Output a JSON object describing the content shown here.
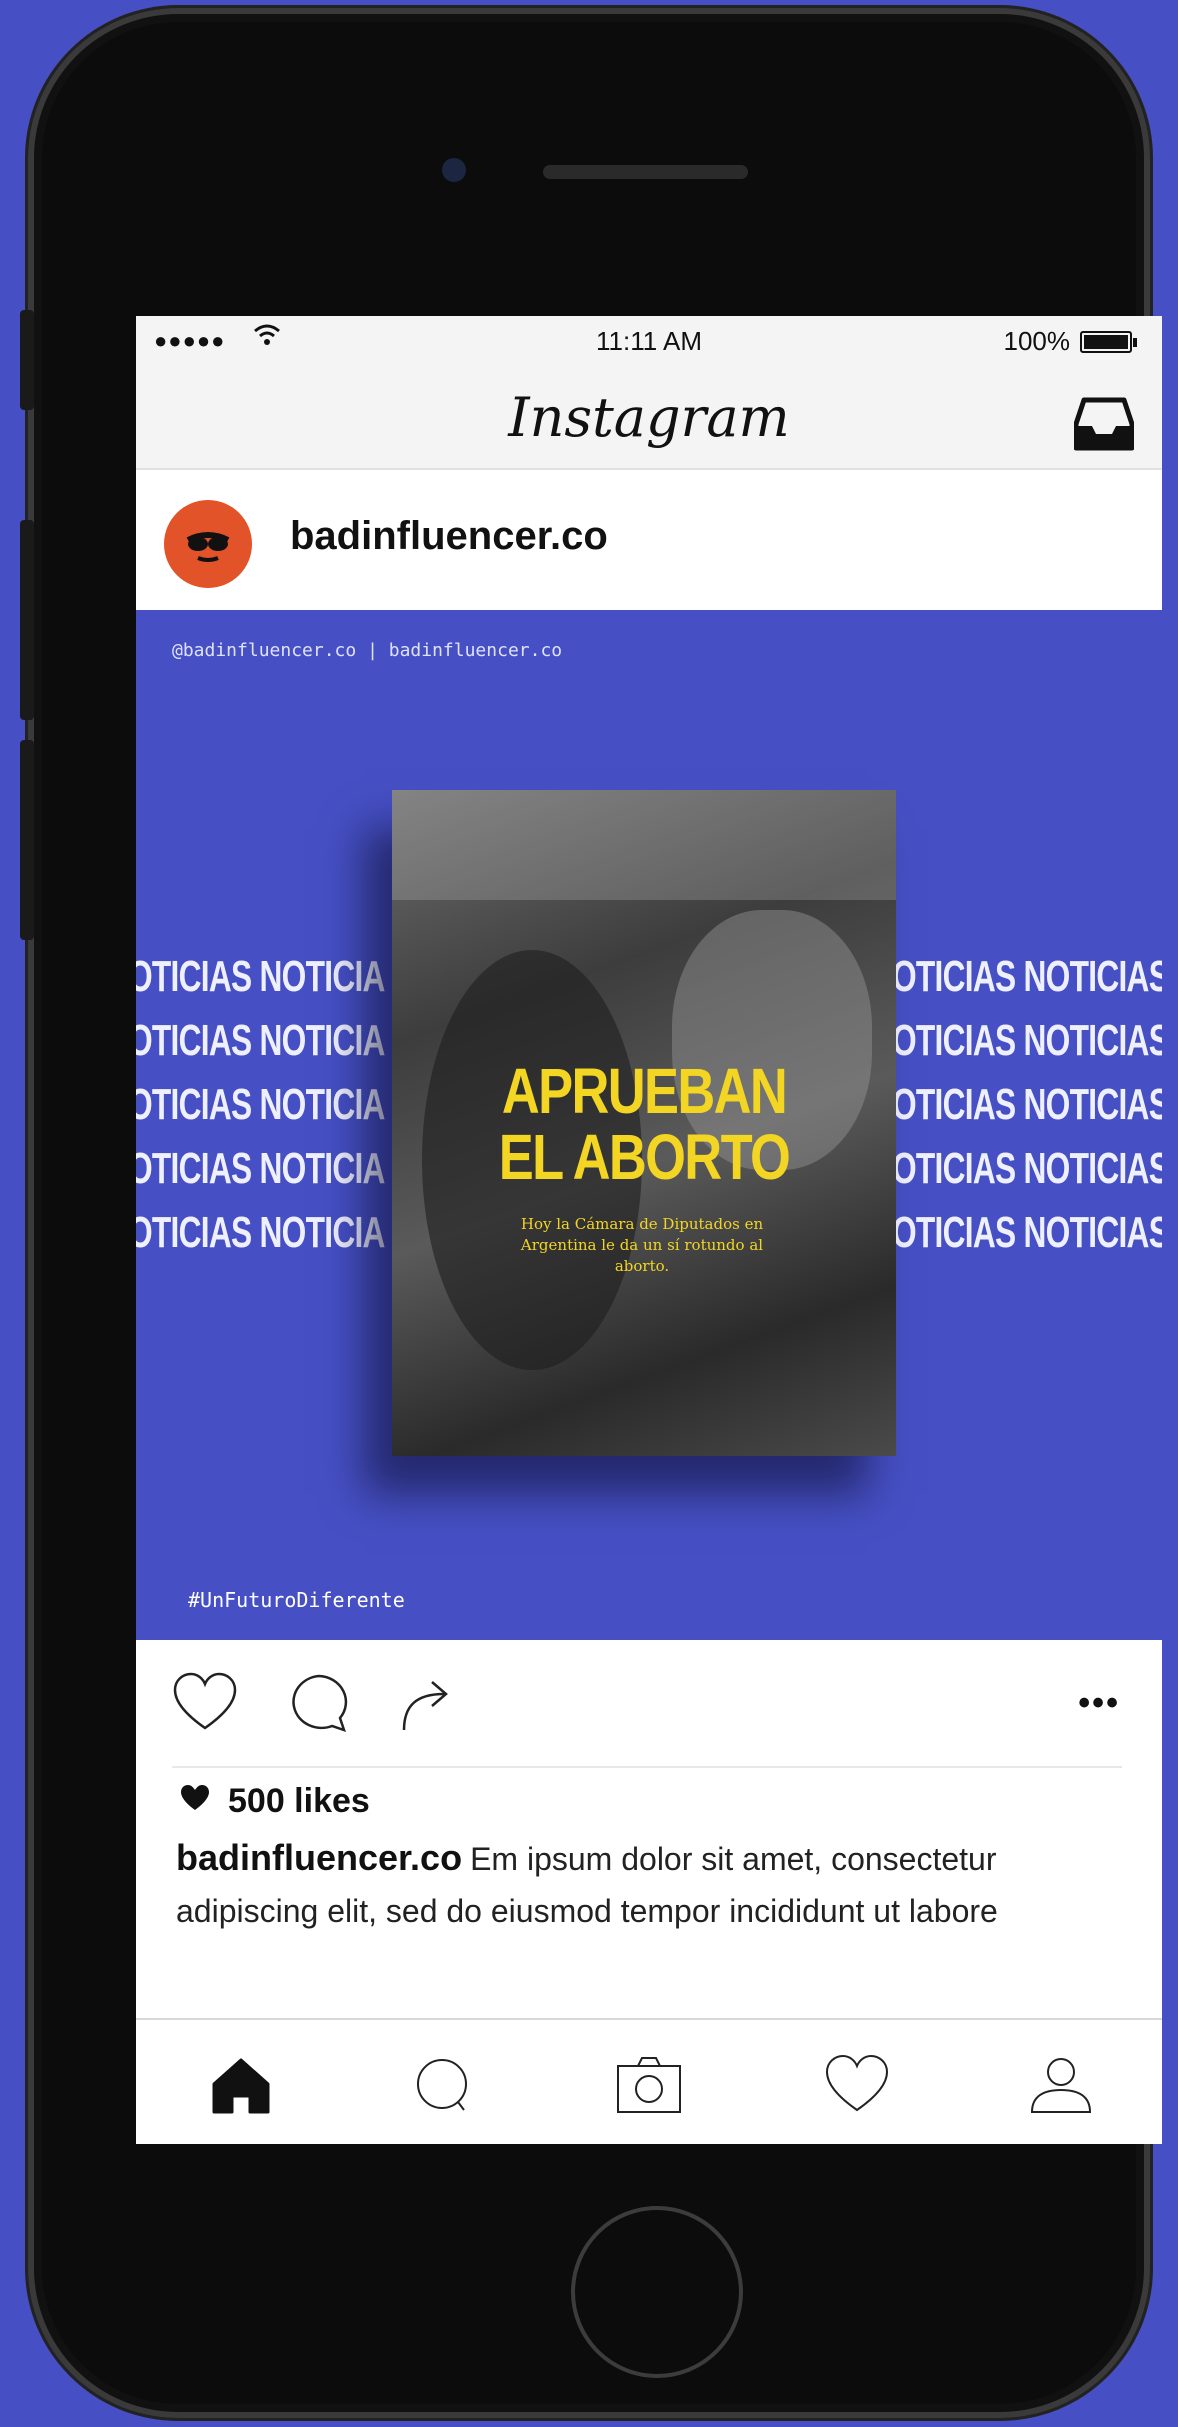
{
  "status_bar": {
    "signal": "●●●●●",
    "time": "11:11 AM",
    "battery": "100%"
  },
  "app": {
    "logo": "Instagram"
  },
  "post": {
    "username": "badinfluencer.co",
    "credits": "@badinfluencer.co | badinfluencer.co",
    "hashtag": "#UnFuturoDiferente",
    "news_word_left": "OTICIAS NOTICIA",
    "news_word_right": "OTICIAS NOTICIAS",
    "headline_line1": "APRUEBAN",
    "headline_line2": "EL ABORTO",
    "subtitle": "Hoy la Cámara de Diputados en Argentina le da un sí rotundo al aborto.",
    "likes": "500 likes",
    "caption_user": "badinfluencer.co",
    "caption_text": "Em ipsum dolor sit amet, consectetur adipiscing elit, sed do eiusmod tempor incididunt ut labore"
  },
  "colors": {
    "background": "#4650c4",
    "headline": "#f3d523",
    "avatar": "#e2532a"
  },
  "tabs": [
    "home-icon",
    "search-icon",
    "camera-icon",
    "heart-icon",
    "profile-icon"
  ]
}
